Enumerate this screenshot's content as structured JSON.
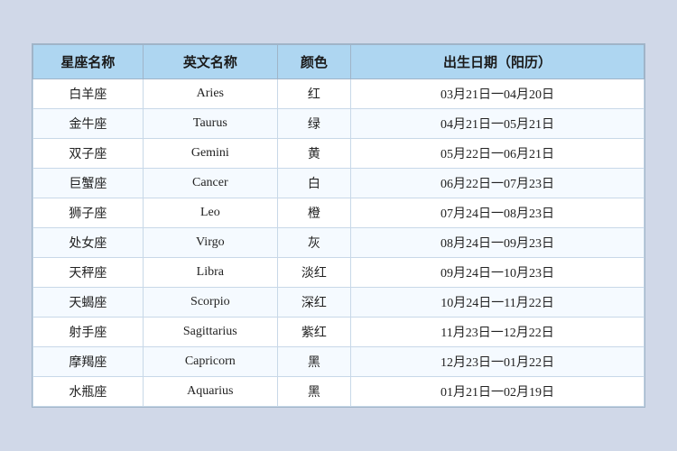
{
  "table": {
    "headers": {
      "chinese_name": "星座名称",
      "english_name": "英文名称",
      "color": "颜色",
      "birth_date": "出生日期（阳历）"
    },
    "rows": [
      {
        "chinese": "白羊座",
        "english": "Aries",
        "color": "红",
        "date": "03月21日一04月20日"
      },
      {
        "chinese": "金牛座",
        "english": "Taurus",
        "color": "绿",
        "date": "04月21日一05月21日"
      },
      {
        "chinese": "双子座",
        "english": "Gemini",
        "color": "黄",
        "date": "05月22日一06月21日"
      },
      {
        "chinese": "巨蟹座",
        "english": "Cancer",
        "color": "白",
        "date": "06月22日一07月23日"
      },
      {
        "chinese": "狮子座",
        "english": "Leo",
        "color": "橙",
        "date": "07月24日一08月23日"
      },
      {
        "chinese": "处女座",
        "english": "Virgo",
        "color": "灰",
        "date": "08月24日一09月23日"
      },
      {
        "chinese": "天秤座",
        "english": "Libra",
        "color": "淡红",
        "date": "09月24日一10月23日"
      },
      {
        "chinese": "天蝎座",
        "english": "Scorpio",
        "color": "深红",
        "date": "10月24日一11月22日"
      },
      {
        "chinese": "射手座",
        "english": "Sagittarius",
        "color": "紫红",
        "date": "11月23日一12月22日"
      },
      {
        "chinese": "摩羯座",
        "english": "Capricorn",
        "color": "黑",
        "date": "12月23日一01月22日"
      },
      {
        "chinese": "水瓶座",
        "english": "Aquarius",
        "color": "黑",
        "date": "01月21日一02月19日"
      }
    ]
  }
}
